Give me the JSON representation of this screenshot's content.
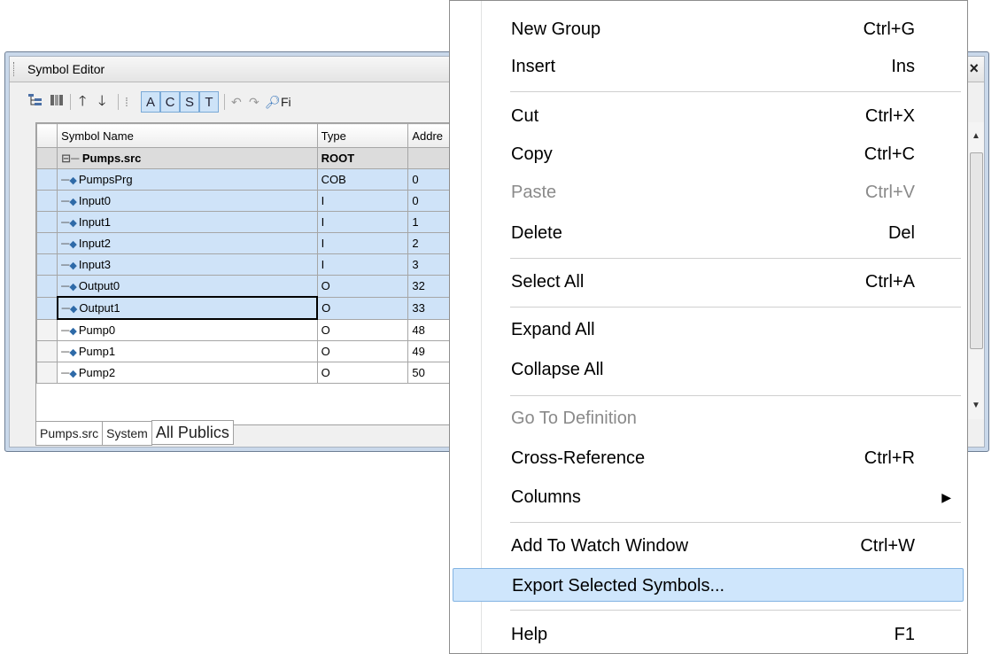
{
  "window": {
    "title": "Symbol Editor",
    "close_glyph": "×"
  },
  "toolbar": {
    "toggle_a": "A",
    "toggle_c": "C",
    "toggle_s": "S",
    "toggle_t": "T",
    "find_label": "Fi"
  },
  "grid": {
    "columns": [
      "Symbol Name",
      "Type",
      "Addre"
    ],
    "rows": [
      {
        "name": "Pumps.src",
        "type": "ROOT",
        "address": ""
      },
      {
        "name": "PumpsPrg",
        "type": "COB",
        "address": "0"
      },
      {
        "name": "Input0",
        "type": "I",
        "address": "0"
      },
      {
        "name": "Input1",
        "type": "I",
        "address": "1"
      },
      {
        "name": "Input2",
        "type": "I",
        "address": "2"
      },
      {
        "name": "Input3",
        "type": "I",
        "address": "3"
      },
      {
        "name": "Output0",
        "type": "O",
        "address": "32"
      },
      {
        "name": "Output1",
        "type": "O",
        "address": "33"
      },
      {
        "name": "Pump0",
        "type": "O",
        "address": "48"
      },
      {
        "name": "Pump1",
        "type": "O",
        "address": "49"
      },
      {
        "name": "Pump2",
        "type": "O",
        "address": "50"
      }
    ]
  },
  "tabs": [
    "Pumps.src",
    "System",
    "All Publics"
  ],
  "menu": {
    "items": [
      {
        "label": "New Group",
        "shortcut": "Ctrl+G"
      },
      {
        "label": "Insert",
        "shortcut": "Ins"
      },
      {
        "label": "Cut",
        "shortcut": "Ctrl+X"
      },
      {
        "label": "Copy",
        "shortcut": "Ctrl+C"
      },
      {
        "label": "Paste",
        "shortcut": "Ctrl+V"
      },
      {
        "label": "Delete",
        "shortcut": "Del"
      },
      {
        "label": "Select All",
        "shortcut": "Ctrl+A"
      },
      {
        "label": "Expand All",
        "shortcut": ""
      },
      {
        "label": "Collapse All",
        "shortcut": ""
      },
      {
        "label": "Go To Definition",
        "shortcut": ""
      },
      {
        "label": "Cross-Reference",
        "shortcut": "Ctrl+R"
      },
      {
        "label": "Columns",
        "shortcut": ""
      },
      {
        "label": "Add To Watch Window",
        "shortcut": "Ctrl+W"
      },
      {
        "label": "Export Selected Symbols...",
        "shortcut": ""
      },
      {
        "label": "Help",
        "shortcut": "F1"
      }
    ],
    "submenu_arrow": "▶"
  }
}
